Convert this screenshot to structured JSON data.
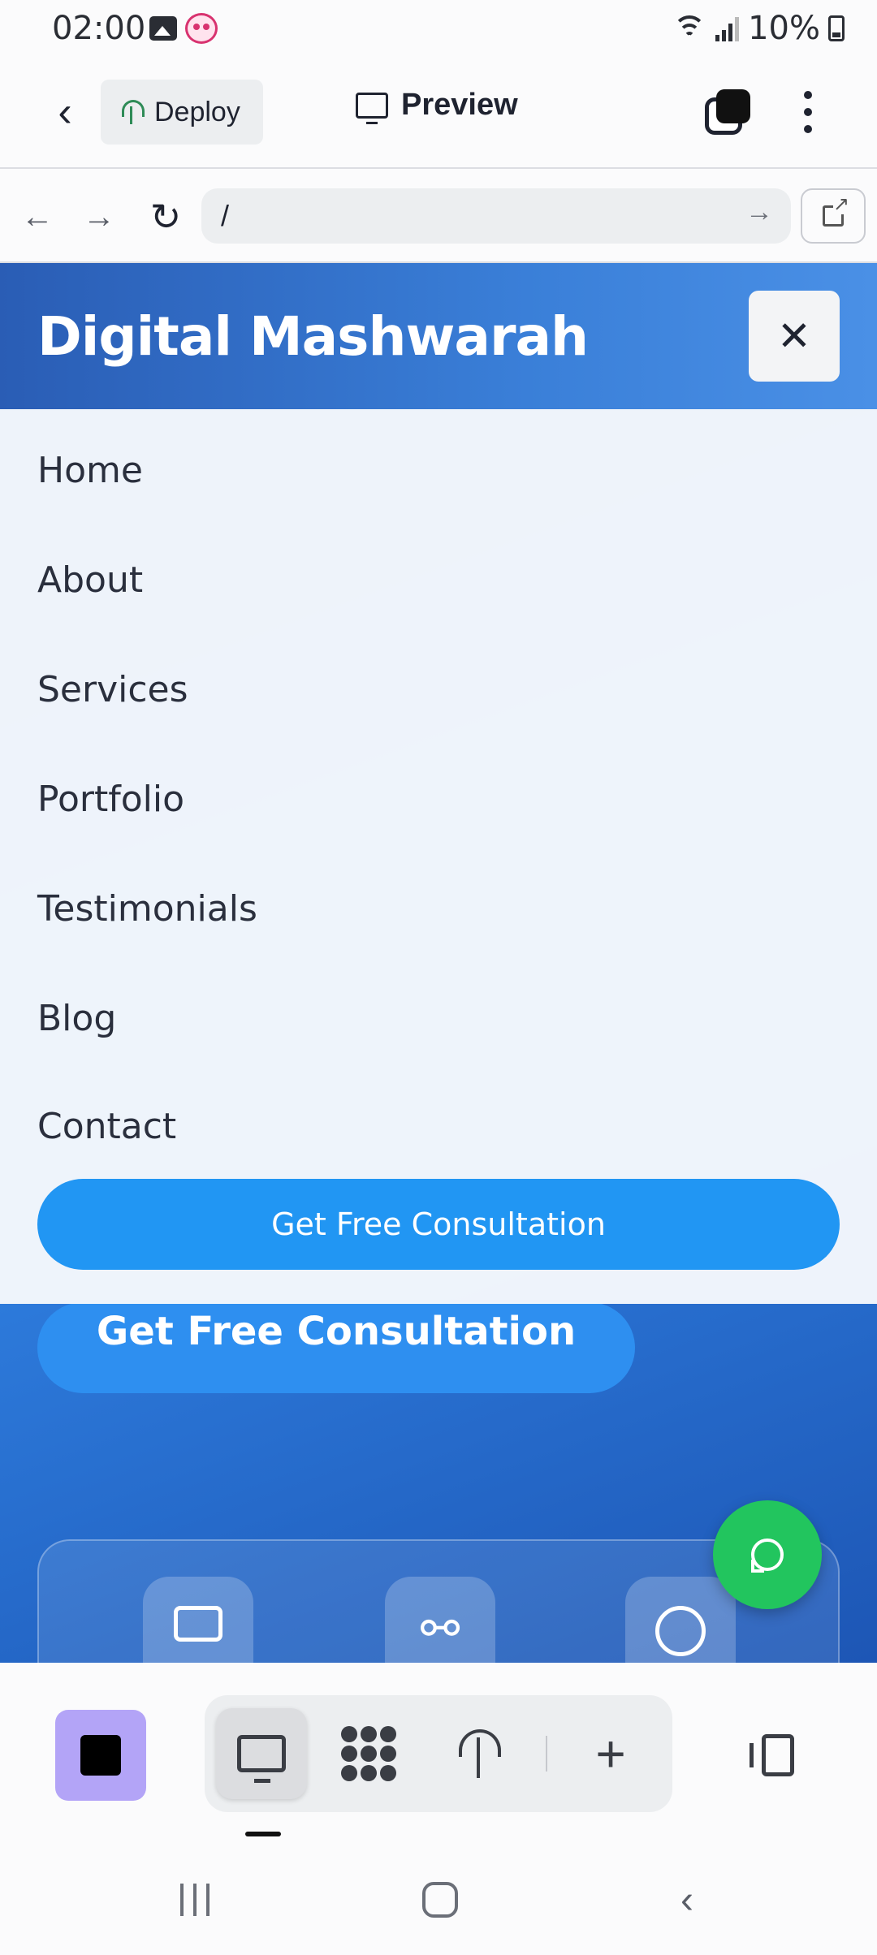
{
  "status_bar": {
    "time": "02:00",
    "battery": "10%"
  },
  "app_header": {
    "deploy_label": "Deploy",
    "title": "Preview"
  },
  "browser": {
    "url": "/"
  },
  "site": {
    "brand": "Digital Mashwarah",
    "nav_items": [
      "Home",
      "About",
      "Services",
      "Portfolio",
      "Testimonials",
      "Blog",
      "Contact"
    ],
    "menu_cta": "Get Free Consultation",
    "hero_cta": "Get Free Consultation"
  },
  "colors": {
    "accent": "#2196f3",
    "header_gradient_start": "#2a5db5",
    "header_gradient_end": "#4a90e6",
    "whatsapp": "#22c55e",
    "project_button": "#b3a4f7"
  },
  "icons": {
    "header": [
      "back-icon",
      "globe-deploy-icon",
      "monitor-icon",
      "tabs-icon",
      "more-vert-icon"
    ],
    "browser": [
      "arrow-left-icon",
      "arrow-right-icon",
      "reload-icon",
      "go-arrow-icon",
      "open-external-icon"
    ],
    "toolbar": [
      "monitor-icon",
      "dots-grid-icon",
      "globe-upload-icon",
      "plus-icon",
      "layout-panel-icon"
    ],
    "system": [
      "recents-icon",
      "home-icon",
      "back-icon"
    ]
  }
}
